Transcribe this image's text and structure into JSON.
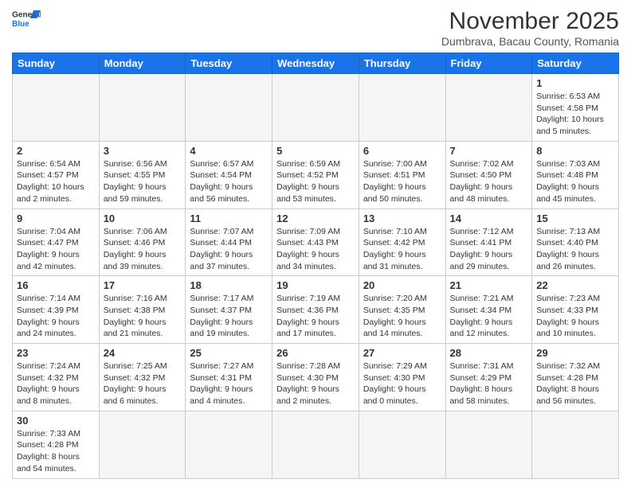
{
  "header": {
    "logo_general": "General",
    "logo_blue": "Blue",
    "month_title": "November 2025",
    "subtitle": "Dumbrava, Bacau County, Romania"
  },
  "weekdays": [
    "Sunday",
    "Monday",
    "Tuesday",
    "Wednesday",
    "Thursday",
    "Friday",
    "Saturday"
  ],
  "weeks": [
    [
      {
        "day": "",
        "info": ""
      },
      {
        "day": "",
        "info": ""
      },
      {
        "day": "",
        "info": ""
      },
      {
        "day": "",
        "info": ""
      },
      {
        "day": "",
        "info": ""
      },
      {
        "day": "",
        "info": ""
      },
      {
        "day": "1",
        "info": "Sunrise: 6:53 AM\nSunset: 4:58 PM\nDaylight: 10 hours and 5 minutes."
      }
    ],
    [
      {
        "day": "2",
        "info": "Sunrise: 6:54 AM\nSunset: 4:57 PM\nDaylight: 10 hours and 2 minutes."
      },
      {
        "day": "3",
        "info": "Sunrise: 6:56 AM\nSunset: 4:55 PM\nDaylight: 9 hours and 59 minutes."
      },
      {
        "day": "4",
        "info": "Sunrise: 6:57 AM\nSunset: 4:54 PM\nDaylight: 9 hours and 56 minutes."
      },
      {
        "day": "5",
        "info": "Sunrise: 6:59 AM\nSunset: 4:52 PM\nDaylight: 9 hours and 53 minutes."
      },
      {
        "day": "6",
        "info": "Sunrise: 7:00 AM\nSunset: 4:51 PM\nDaylight: 9 hours and 50 minutes."
      },
      {
        "day": "7",
        "info": "Sunrise: 7:02 AM\nSunset: 4:50 PM\nDaylight: 9 hours and 48 minutes."
      },
      {
        "day": "8",
        "info": "Sunrise: 7:03 AM\nSunset: 4:48 PM\nDaylight: 9 hours and 45 minutes."
      }
    ],
    [
      {
        "day": "9",
        "info": "Sunrise: 7:04 AM\nSunset: 4:47 PM\nDaylight: 9 hours and 42 minutes."
      },
      {
        "day": "10",
        "info": "Sunrise: 7:06 AM\nSunset: 4:46 PM\nDaylight: 9 hours and 39 minutes."
      },
      {
        "day": "11",
        "info": "Sunrise: 7:07 AM\nSunset: 4:44 PM\nDaylight: 9 hours and 37 minutes."
      },
      {
        "day": "12",
        "info": "Sunrise: 7:09 AM\nSunset: 4:43 PM\nDaylight: 9 hours and 34 minutes."
      },
      {
        "day": "13",
        "info": "Sunrise: 7:10 AM\nSunset: 4:42 PM\nDaylight: 9 hours and 31 minutes."
      },
      {
        "day": "14",
        "info": "Sunrise: 7:12 AM\nSunset: 4:41 PM\nDaylight: 9 hours and 29 minutes."
      },
      {
        "day": "15",
        "info": "Sunrise: 7:13 AM\nSunset: 4:40 PM\nDaylight: 9 hours and 26 minutes."
      }
    ],
    [
      {
        "day": "16",
        "info": "Sunrise: 7:14 AM\nSunset: 4:39 PM\nDaylight: 9 hours and 24 minutes."
      },
      {
        "day": "17",
        "info": "Sunrise: 7:16 AM\nSunset: 4:38 PM\nDaylight: 9 hours and 21 minutes."
      },
      {
        "day": "18",
        "info": "Sunrise: 7:17 AM\nSunset: 4:37 PM\nDaylight: 9 hours and 19 minutes."
      },
      {
        "day": "19",
        "info": "Sunrise: 7:19 AM\nSunset: 4:36 PM\nDaylight: 9 hours and 17 minutes."
      },
      {
        "day": "20",
        "info": "Sunrise: 7:20 AM\nSunset: 4:35 PM\nDaylight: 9 hours and 14 minutes."
      },
      {
        "day": "21",
        "info": "Sunrise: 7:21 AM\nSunset: 4:34 PM\nDaylight: 9 hours and 12 minutes."
      },
      {
        "day": "22",
        "info": "Sunrise: 7:23 AM\nSunset: 4:33 PM\nDaylight: 9 hours and 10 minutes."
      }
    ],
    [
      {
        "day": "23",
        "info": "Sunrise: 7:24 AM\nSunset: 4:32 PM\nDaylight: 9 hours and 8 minutes."
      },
      {
        "day": "24",
        "info": "Sunrise: 7:25 AM\nSunset: 4:32 PM\nDaylight: 9 hours and 6 minutes."
      },
      {
        "day": "25",
        "info": "Sunrise: 7:27 AM\nSunset: 4:31 PM\nDaylight: 9 hours and 4 minutes."
      },
      {
        "day": "26",
        "info": "Sunrise: 7:28 AM\nSunset: 4:30 PM\nDaylight: 9 hours and 2 minutes."
      },
      {
        "day": "27",
        "info": "Sunrise: 7:29 AM\nSunset: 4:30 PM\nDaylight: 9 hours and 0 minutes."
      },
      {
        "day": "28",
        "info": "Sunrise: 7:31 AM\nSunset: 4:29 PM\nDaylight: 8 hours and 58 minutes."
      },
      {
        "day": "29",
        "info": "Sunrise: 7:32 AM\nSunset: 4:28 PM\nDaylight: 8 hours and 56 minutes."
      }
    ],
    [
      {
        "day": "30",
        "info": "Sunrise: 7:33 AM\nSunset: 4:28 PM\nDaylight: 8 hours and 54 minutes."
      },
      {
        "day": "",
        "info": ""
      },
      {
        "day": "",
        "info": ""
      },
      {
        "day": "",
        "info": ""
      },
      {
        "day": "",
        "info": ""
      },
      {
        "day": "",
        "info": ""
      },
      {
        "day": "",
        "info": ""
      }
    ]
  ]
}
